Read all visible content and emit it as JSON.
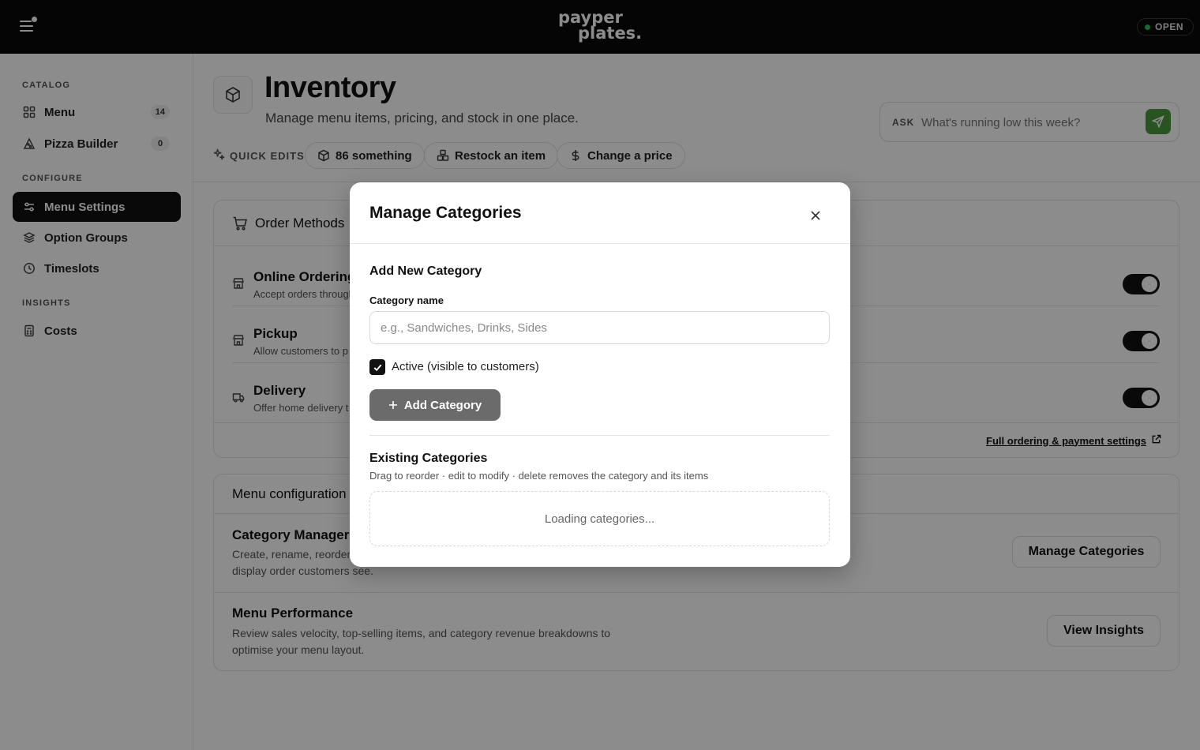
{
  "topbar": {
    "brand_line1": "payper",
    "brand_line2": "plates.",
    "status": "OPEN",
    "colors": {
      "background": "#0a0a0a",
      "status_dot": "#22c55e"
    }
  },
  "sidebar": {
    "sections": [
      {
        "title": "CATALOG"
      },
      {
        "title": "CONFIGURE"
      },
      {
        "title": "INSIGHTS"
      }
    ],
    "items": [
      {
        "label": "Menu",
        "icon": "grid-icon",
        "count": "14"
      },
      {
        "label": "Pizza Builder",
        "icon": "pizza-icon",
        "count": "0"
      },
      {
        "label": "Menu Settings",
        "icon": "sliders-icon",
        "active": true
      },
      {
        "label": "Option Groups",
        "icon": "layers-icon"
      },
      {
        "label": "Timeslots",
        "icon": "clock-icon"
      },
      {
        "label": "Costs",
        "icon": "calculator-icon"
      }
    ]
  },
  "header": {
    "title": "Inventory",
    "subtitle": "Manage menu items, pricing, and stock in one place.",
    "ask_label": "ASK",
    "ask_placeholder": "What's running low this week?",
    "quick_edits_label": "QUICK EDITS",
    "quick_edits": [
      {
        "label": "86 something",
        "icon": "box-icon"
      },
      {
        "label": "Restock an item",
        "icon": "boxes-icon"
      },
      {
        "label": "Change a price",
        "icon": "dollar-icon"
      }
    ],
    "accent_color": "#4c9a3f"
  },
  "order_methods": {
    "title": "Order Methods",
    "methods": [
      {
        "title": "Online Ordering",
        "desc": "Accept orders through",
        "enabled": true,
        "icon": "store-icon"
      },
      {
        "title": "Pickup",
        "desc": "Allow customers to p",
        "enabled": true,
        "icon": "store-icon"
      },
      {
        "title": "Delivery",
        "desc": "Offer home delivery t",
        "enabled": true,
        "icon": "truck-icon"
      }
    ],
    "link": "Full ordering & payment settings"
  },
  "menu_config": {
    "title": "Menu configuration",
    "rows": [
      {
        "title": "Category Manager",
        "desc": "Create, rename, reorder\ndisplay order customers see.",
        "button": "Manage Categories"
      },
      {
        "title": "Menu Performance",
        "desc": "Review sales velocity, top-selling items, and category revenue breakdowns to optimise your menu layout.",
        "button": "View Insights"
      }
    ]
  },
  "modal": {
    "title": "Manage Categories",
    "add_section_title": "Add New Category",
    "field_label": "Category name",
    "field_placeholder": "e.g., Sandwiches, Drinks, Sides",
    "field_value": "",
    "checkbox_label": "Active (visible to customers)",
    "checkbox_checked": true,
    "add_button": "Add Category",
    "existing_title": "Existing Categories",
    "existing_helper": "Drag to reorder · edit to modify · delete removes the category and its items",
    "loading_text": "Loading categories..."
  }
}
